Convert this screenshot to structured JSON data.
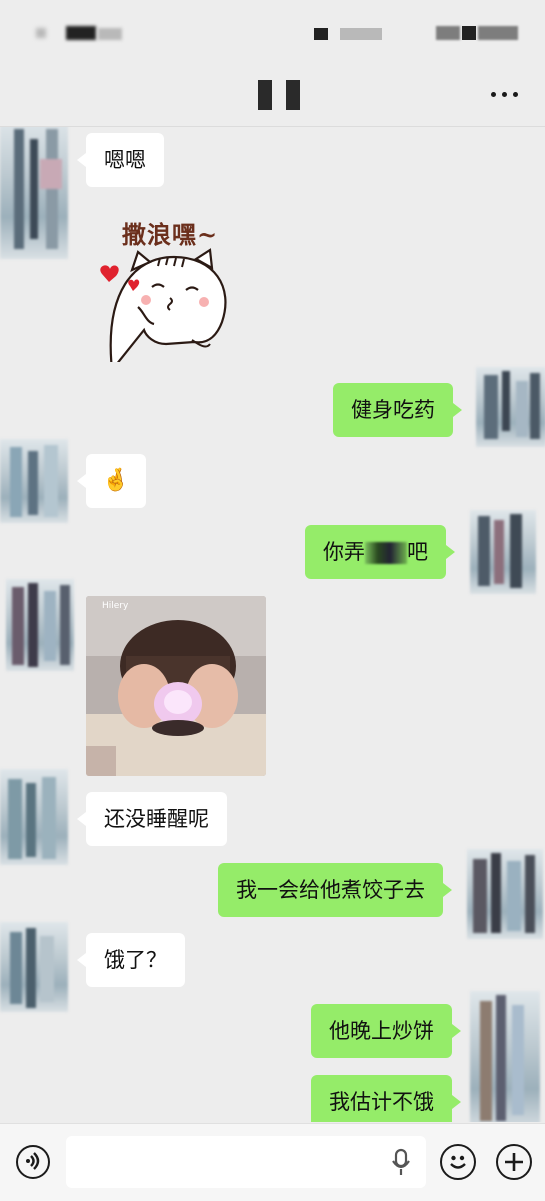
{
  "chat": {
    "messages": [
      {
        "side": "left",
        "type": "text",
        "text": "嗯嗯"
      },
      {
        "side": "left",
        "type": "sticker",
        "text": "撒浪嘿~"
      },
      {
        "side": "right",
        "type": "text",
        "text": "健身吃药"
      },
      {
        "side": "left",
        "type": "emoji",
        "text": "🤞"
      },
      {
        "side": "right",
        "type": "text",
        "text_before": "你弄",
        "text_after": "吧"
      },
      {
        "side": "left",
        "type": "image",
        "watermark": "Hilery"
      },
      {
        "side": "left",
        "type": "text",
        "text": "还没睡醒呢"
      },
      {
        "side": "right",
        "type": "text",
        "text": "我一会给他煮饺子去"
      },
      {
        "side": "left",
        "type": "text",
        "text": "饿了？"
      },
      {
        "side": "right",
        "type": "text",
        "text": "他晚上炒饼"
      },
      {
        "side": "right",
        "type": "text",
        "text": "我估计不饿"
      }
    ]
  },
  "navbar": {
    "more_icon": "more-horizontal-icon"
  },
  "input": {
    "voice_icon": "voice-icon",
    "mic_icon": "microphone-icon",
    "emoji_icon": "emoji-icon",
    "plus_icon": "plus-icon",
    "placeholder": ""
  },
  "colors": {
    "background": "#ededed",
    "bubble_left": "#ffffff",
    "bubble_right": "#95ec69"
  }
}
